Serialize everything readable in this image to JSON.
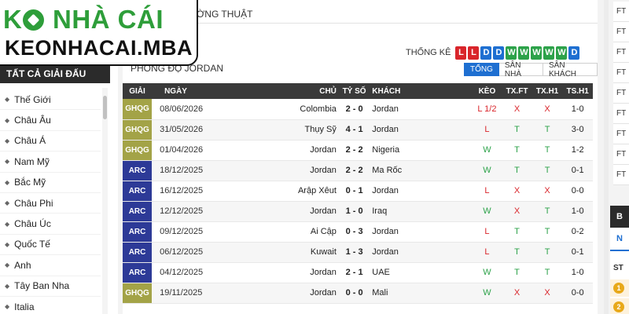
{
  "logo": {
    "line1_part1": "K",
    "line1_part2": "È",
    "line1_part3": " NHÀ CÁI",
    "line2": "KEONHACAI.MBA",
    "brand_green": "#2e9e3a"
  },
  "top_tab": {
    "label": "ỜNG THUẬT"
  },
  "sidebar": {
    "header": "TẤT CẢ GIẢI ĐẤU",
    "items": [
      "Thế Giới",
      "Châu Âu",
      "Châu Á",
      "Nam Mỹ",
      "Bắc Mỹ",
      "Châu Phi",
      "Châu Úc",
      "Quốc Tế",
      "Anh",
      "Tây Ban Nha",
      "Italia"
    ]
  },
  "form": {
    "title": "PHONG ĐỘ JORDAN",
    "stats_label": "THỐNG KÊ",
    "sequence": [
      "L",
      "L",
      "D",
      "D",
      "W",
      "W",
      "W",
      "W",
      "W",
      "D"
    ],
    "filters": [
      {
        "label": "TỔNG",
        "active": true
      },
      {
        "label": "SÂN NHÀ",
        "active": false
      },
      {
        "label": "SÂN KHÁCH",
        "active": false
      }
    ]
  },
  "table": {
    "headers": {
      "league": "GIẢI",
      "date": "NGÀY",
      "home": "CHỦ",
      "score": "TỶ SỐ",
      "away": "KHÁCH",
      "keo": "KÈO",
      "txft": "TX.FT",
      "txh1": "TX.H1",
      "tsh1": "TS.H1"
    },
    "rows": [
      {
        "league": "GHQG",
        "date": "08/06/2026",
        "home": "Colombia",
        "score": "2 - 0",
        "away": "Jordan",
        "keo": "L 1/2",
        "txft": "X",
        "txh1": "X",
        "tsh1": "1-0"
      },
      {
        "league": "GHQG",
        "date": "31/05/2026",
        "home": "Thụy Sỹ",
        "score": "4 - 1",
        "away": "Jordan",
        "keo": "L",
        "txft": "T",
        "txh1": "T",
        "tsh1": "3-0"
      },
      {
        "league": "GHQG",
        "date": "01/04/2026",
        "home": "Jordan",
        "score": "2 - 2",
        "away": "Nigeria",
        "keo": "W",
        "txft": "T",
        "txh1": "T",
        "tsh1": "1-2"
      },
      {
        "league": "ARC",
        "date": "18/12/2025",
        "home": "Jordan",
        "score": "2 - 2",
        "away": "Ma Rốc",
        "keo": "W",
        "txft": "T",
        "txh1": "T",
        "tsh1": "0-1"
      },
      {
        "league": "ARC",
        "date": "16/12/2025",
        "home": "Arập Xêut",
        "score": "0 - 1",
        "away": "Jordan",
        "keo": "L",
        "txft": "X",
        "txh1": "X",
        "tsh1": "0-0"
      },
      {
        "league": "ARC",
        "date": "12/12/2025",
        "home": "Jordan",
        "score": "1 - 0",
        "away": "Iraq",
        "keo": "W",
        "txft": "X",
        "txh1": "T",
        "tsh1": "1-0"
      },
      {
        "league": "ARC",
        "date": "09/12/2025",
        "home": "Ai Cập",
        "score": "0 - 3",
        "away": "Jordan",
        "keo": "L",
        "txft": "T",
        "txh1": "T",
        "tsh1": "0-2"
      },
      {
        "league": "ARC",
        "date": "06/12/2025",
        "home": "Kuwait",
        "score": "1 - 3",
        "away": "Jordan",
        "keo": "L",
        "txft": "T",
        "txh1": "T",
        "tsh1": "0-1"
      },
      {
        "league": "ARC",
        "date": "04/12/2025",
        "home": "Jordan",
        "score": "2 - 1",
        "away": "UAE",
        "keo": "W",
        "txft": "T",
        "txh1": "T",
        "tsh1": "1-0"
      },
      {
        "league": "GHQG",
        "date": "19/11/2025",
        "home": "Jordan",
        "score": "0 - 0",
        "away": "Mali",
        "keo": "W",
        "txft": "X",
        "txh1": "X",
        "tsh1": "0-0"
      }
    ]
  },
  "right_panel": {
    "ft_labels": [
      "FT",
      "FT",
      "FT",
      "FT",
      "FT",
      "FT",
      "FT",
      "FT",
      "FT"
    ],
    "block_label": "B",
    "tab_label": "N",
    "st_label": "ST",
    "ranks": [
      "1",
      "2"
    ]
  },
  "colors": {
    "win": "#2da24a",
    "loss": "#d9252b",
    "draw": "#1e6fd1",
    "ghqg": "#a3a347",
    "arc": "#2d3a97"
  }
}
